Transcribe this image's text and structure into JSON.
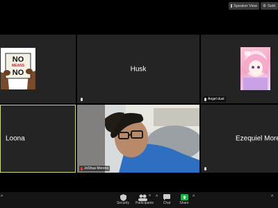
{
  "top_bar": {
    "speaker_view_label": "Speaker View",
    "settings_label": "Setti"
  },
  "tiles": {
    "no_means_no": {
      "sign_text": "NO MEANS NO"
    },
    "husk": {
      "name": "Husk"
    },
    "angel_dust": {
      "name": "Angel dust"
    },
    "loona": {
      "name": "Loona"
    },
    "joshua": {
      "name": "JoShua Moreno"
    },
    "ezequiel": {
      "name": "Ezequiel More"
    }
  },
  "toolbar": {
    "security_label": "Security",
    "participants_label": "Participants",
    "participants_count": "6",
    "chat_label": "Chat",
    "share_label": "Share"
  },
  "colors": {
    "active_speaker_border": "#cfe27a",
    "tile_bg": "#242424",
    "share_green": "#22b04b"
  }
}
